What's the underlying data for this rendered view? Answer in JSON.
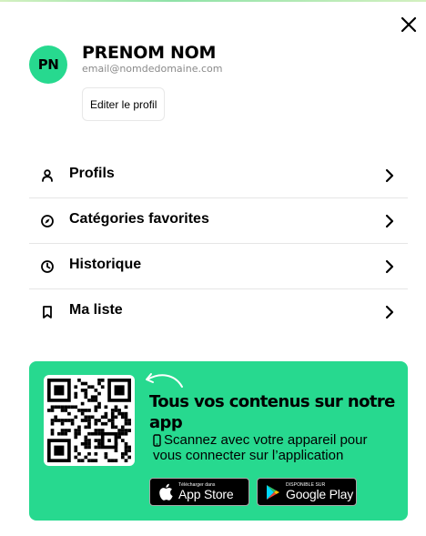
{
  "colors": {
    "accent": "#27d98f",
    "text": "#000000",
    "muted": "#8a8a8a",
    "divider": "#e6e6e6"
  },
  "header": {
    "close_icon": "close-icon"
  },
  "profile": {
    "initials": "PN",
    "name": "PRENOM NOM",
    "email": "email@nomdedomaine.com",
    "edit_label": "Editer le profil"
  },
  "menu": {
    "items": [
      {
        "label": "Profils",
        "icon": "person-icon"
      },
      {
        "label": "Catégories favorites",
        "icon": "compass-icon"
      },
      {
        "label": "Historique",
        "icon": "clock-icon"
      },
      {
        "label": "Ma liste",
        "icon": "bookmark-icon"
      }
    ]
  },
  "promo": {
    "title": "Tous vos contenus sur notre app",
    "text_line1": "Scannez avec votre appareil pour",
    "text_line2": "vous connecter sur l’application",
    "app_store": {
      "small": "Télécharger dans",
      "big": "App Store"
    },
    "google_play": {
      "small": "Disponible sur",
      "big": "Google Play"
    }
  }
}
